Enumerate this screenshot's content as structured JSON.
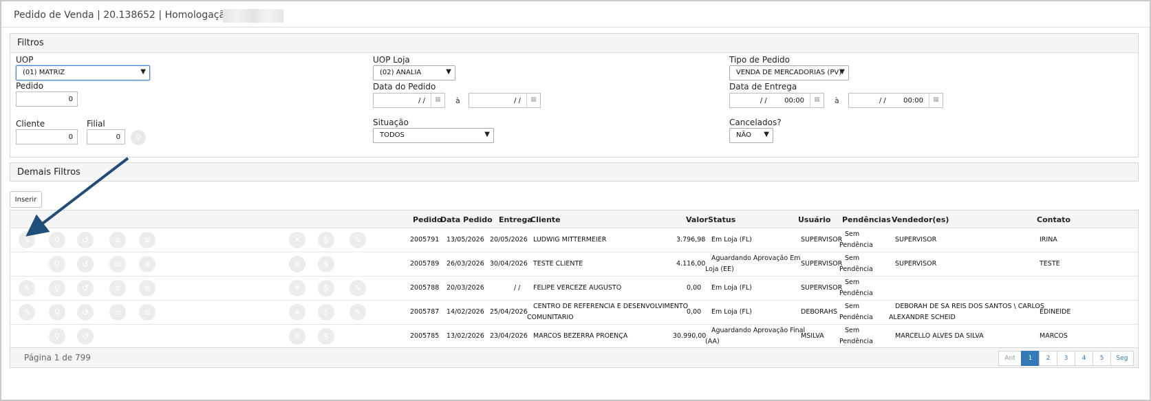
{
  "header": {
    "title": "Pedido de Venda | 20.138652 | Homologação |"
  },
  "filtros": {
    "heading": "Filtros",
    "uop": {
      "label": "UOP",
      "value": "(01) MATRIZ"
    },
    "uop_loja": {
      "label": "UOP Loja",
      "value": "(02) ANALIA"
    },
    "tipo_pedido": {
      "label": "Tipo de Pedido",
      "value": "VENDA DE MERCADORIAS (PV)"
    },
    "pedido": {
      "label": "Pedido",
      "value": "0"
    },
    "data_pedido": {
      "label": "Data do Pedido",
      "from": "/ /",
      "to": "/ /",
      "sep": "à"
    },
    "data_entrega": {
      "label": "Data de Entrega",
      "from": "/ /        00:00",
      "to": "/ /        00:00",
      "sep": "à"
    },
    "cliente": {
      "label": "Cliente",
      "value": "0"
    },
    "filial": {
      "label": "Filial",
      "value": "0"
    },
    "situacao": {
      "label": "Situação",
      "value": "TODOS"
    },
    "cancelados": {
      "label": "Cancelados?",
      "value": "NÃO"
    }
  },
  "demais_filtros": {
    "heading": "Demais Filtros"
  },
  "toolbar": {
    "inserir_label": "Inserir"
  },
  "table": {
    "columns": {
      "pedido": "Pedido",
      "data_pedido": "Data Pedido",
      "entrega": "Entrega",
      "cliente": "Cliente",
      "valor": "Valor",
      "status": "Status",
      "usuario": "Usuário",
      "pendencias": "Pendências",
      "vendedores": "Vendedor(es)",
      "contato": "Contato"
    },
    "rows": [
      {
        "pedido": "2005791",
        "data": "13/05/2026",
        "entrega": "20/05/2026",
        "cliente": "LUDWIG MITTERMEIER",
        "valor": "3.796,98",
        "status": "Em Loja (FL)",
        "usuario": "SUPERVISOR",
        "pend1": "Sem",
        "pend2": "Pendência",
        "vend1": "SUPERVISOR",
        "vend2": "",
        "contato": "IRINA"
      },
      {
        "pedido": "2005789",
        "data": "26/03/2026",
        "entrega": "30/04/2026",
        "cliente": "TESTE CLIENTE",
        "valor": "4.116,00",
        "status": "Aguardando Aprovação Em",
        "status2": "Loja (EE)",
        "usuario": "SUPERVISOR",
        "pend1": "Sem",
        "pend2": "Pendência",
        "vend1": "SUPERVISOR",
        "vend2": "",
        "contato": "TESTE"
      },
      {
        "pedido": "2005788",
        "data": "20/03/2026",
        "entrega": "/ /",
        "cliente": "FELIPE VERCEZE AUGUSTO",
        "valor": "0,00",
        "status": "Em Loja (FL)",
        "usuario": "SUPERVISOR",
        "pend1": "Sem",
        "pend2": "Pendência",
        "vend1": "",
        "vend2": "",
        "contato": ""
      },
      {
        "pedido": "2005787",
        "data": "14/02/2026",
        "entrega": "25/04/2026",
        "cliente": "CENTRO DE REFERENCIA E DESENVOLVIMENTO",
        "cliente2": "COMUNITARIO",
        "valor": "0,00",
        "status": "Em Loja (FL)",
        "usuario": "DEBORAHS",
        "pend1": "Sem",
        "pend2": "Pendência",
        "vend1": "DEBORAH DE SA REIS DOS SANTOS \\ CARLOS",
        "vend2": "ALEXANDRE SCHEID",
        "contato": "EDINEIDE"
      },
      {
        "pedido": "2005785",
        "data": "13/02/2026",
        "entrega": "23/04/2026",
        "cliente": "MARCOS BEZERRA PROENÇA",
        "valor": "30.990,00",
        "status": "Aguardando Aprovação Final",
        "status2": "(AA)",
        "usuario": "MSILVA",
        "pend1": "Sem",
        "pend2": "Pendência",
        "vend1": "MARCELLO ALVES DA SILVA",
        "vend2": "",
        "contato": "MARCOS"
      }
    ]
  },
  "footer": {
    "page_info": "Página 1 de 799",
    "pager": [
      "Ant",
      "1",
      "2",
      "3",
      "4",
      "5",
      "Seg"
    ]
  }
}
